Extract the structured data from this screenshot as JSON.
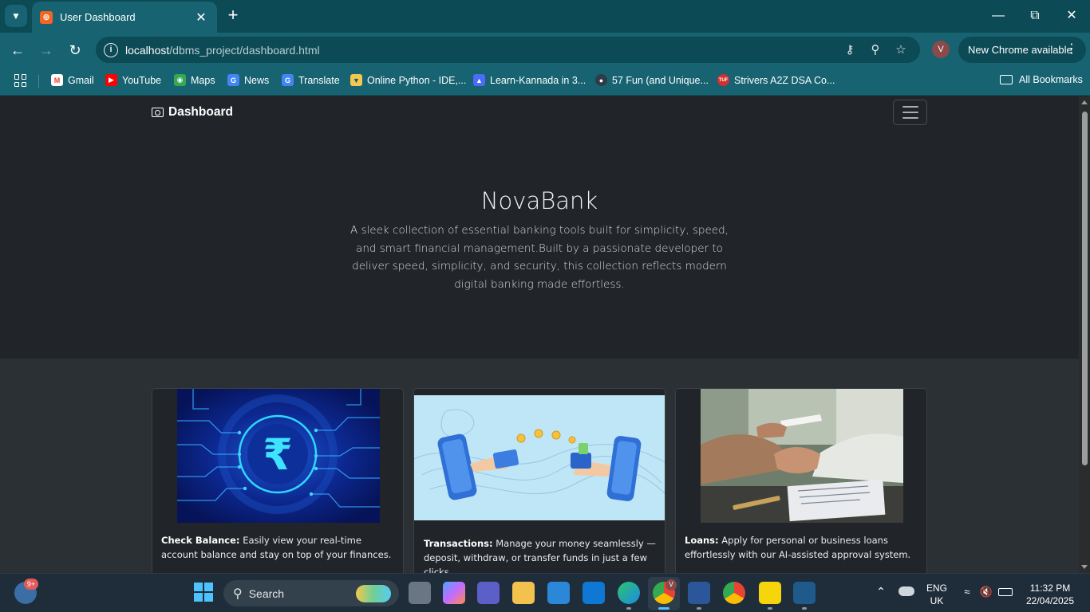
{
  "browser": {
    "tab_title": "User Dashboard",
    "url_host": "localhost",
    "url_path": "/dbms_project/dashboard.html",
    "profile_initial": "V",
    "update_label": "New Chrome available",
    "bookmarks": [
      {
        "label": "Gmail",
        "icon": "gmail-icon",
        "color": "#ea4335"
      },
      {
        "label": "YouTube",
        "icon": "youtube-icon",
        "color": "#ff0000"
      },
      {
        "label": "Maps",
        "icon": "maps-icon",
        "color": "#34a853"
      },
      {
        "label": "News",
        "icon": "news-icon",
        "color": "#4285f4"
      },
      {
        "label": "Translate",
        "icon": "translate-icon",
        "color": "#4285f4"
      },
      {
        "label": "Online Python - IDE,...",
        "icon": "python-icon",
        "color": "#f2c94c"
      },
      {
        "label": "Learn-Kannada in 3...",
        "icon": "kannada-icon",
        "color": "#4a6cf7"
      },
      {
        "label": "57 Fun (and Unique...",
        "icon": "globe-icon",
        "color": "#2f3b46"
      },
      {
        "label": "Strivers A2Z DSA Co...",
        "icon": "tuf-icon",
        "color": "#d32f2f"
      }
    ],
    "all_bookmarks_label": "All Bookmarks"
  },
  "page": {
    "brand": "Dashboard",
    "hero": {
      "title": "NovaBank",
      "description": "A sleek collection of essential banking tools built for simplicity, speed, and smart financial management.Built by a passionate developer to deliver speed, simplicity, and security, this collection reflects modern digital banking made effortless."
    },
    "cards": [
      {
        "title": "Check Balance:",
        "text": "Easily view your real-time account balance and stay on top of your finances.",
        "image": "rupee-circuit-image"
      },
      {
        "title": "Transactions:",
        "text": "Manage your money seamlessly — deposit, withdraw, or transfer funds in just a few clicks.",
        "image": "phones-transfer-image"
      },
      {
        "title": "Loans:",
        "text": "Apply for personal or business loans effortlessly with our AI-assisted approval system.",
        "image": "handshake-image"
      }
    ]
  },
  "taskbar": {
    "search_label": "Search",
    "notification_badge": "9+",
    "lang_line1": "ENG",
    "lang_line2": "UK",
    "time": "11:32 PM",
    "date": "22/04/2025",
    "chrome_profile_badge": "V"
  },
  "colors": {
    "chrome_dark": "#0c4a55",
    "chrome_light": "#176371",
    "page_bg": "#212529",
    "section_bg": "#2b3035"
  }
}
